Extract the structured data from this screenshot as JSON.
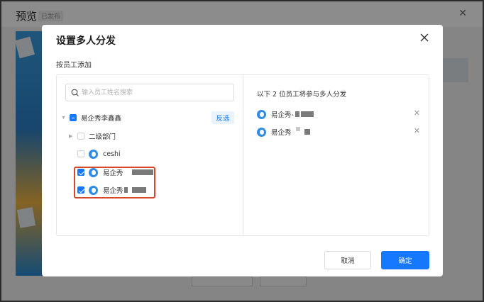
{
  "background": {
    "page_title": "预览",
    "status_badge": "已发布"
  },
  "modal": {
    "title": "设置多人分发",
    "section_label": "按员工添加",
    "search": {
      "placeholder": "输入员工姓名搜索"
    },
    "tree": {
      "root": {
        "label": "易企秀李鑫鑫",
        "checkbox": "partial",
        "invert_label": "反选"
      },
      "department": {
        "label": "二级部门",
        "checked": false
      },
      "users": [
        {
          "label": "ceshi",
          "checked": false
        },
        {
          "label": "易企秀",
          "checked": true,
          "redacted": true
        },
        {
          "label": "易企秀",
          "checked": true,
          "redacted": true
        }
      ]
    },
    "selected": {
      "summary": "以下 2 位员工将参与多人分发",
      "items": [
        {
          "label": "易企秀-",
          "redacted": true
        },
        {
          "label": "易企秀",
          "redacted": true
        }
      ]
    },
    "buttons": {
      "cancel": "取消",
      "ok": "确定"
    }
  },
  "colors": {
    "primary": "#1677ff",
    "highlight": "#d9472b",
    "avatar": "#2f8be6"
  }
}
